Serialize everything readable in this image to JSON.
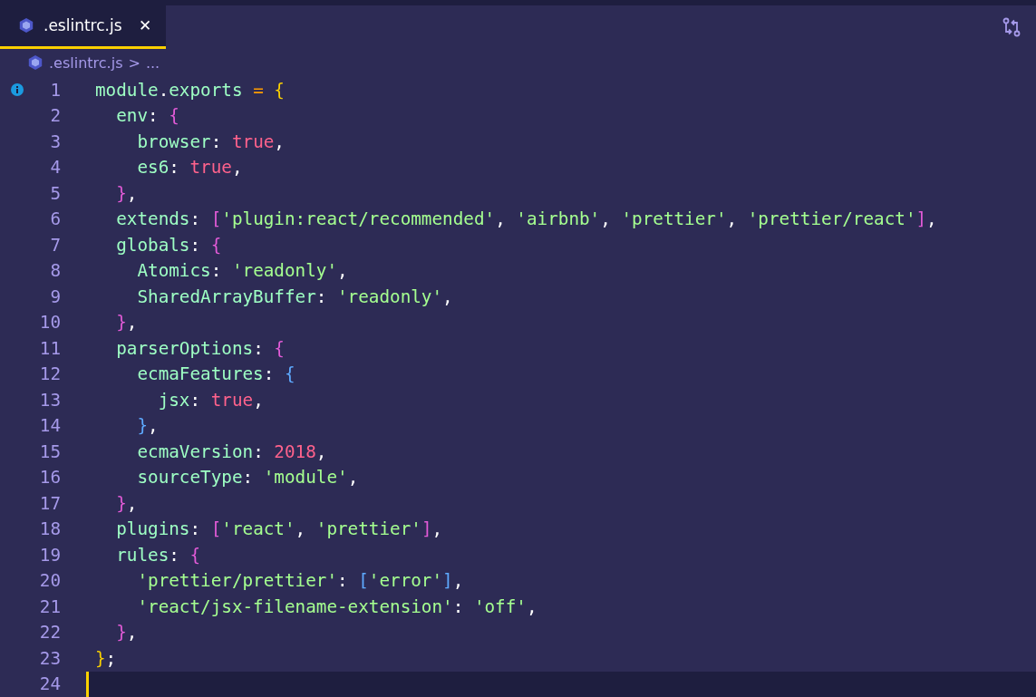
{
  "tab": {
    "title": ".eslintrc.js",
    "close": "✕",
    "selected": true
  },
  "breadcrumb": {
    "file": ".eslintrc.js",
    "separator": ">",
    "more": "..."
  },
  "lines": [
    {
      "number": "1",
      "info": true,
      "current": false,
      "tokens": [
        {
          "kind": "ident",
          "text": "module"
        },
        {
          "kind": "punct",
          "text": "."
        },
        {
          "kind": "ident",
          "text": "exports"
        },
        {
          "kind": "op",
          "text": " = "
        },
        {
          "kind": "open",
          "text": "{"
        }
      ]
    },
    {
      "number": "2",
      "info": false,
      "current": false,
      "tokens": [
        {
          "kind": "ident",
          "text": "  env"
        },
        {
          "kind": "punct",
          "text": ": "
        },
        {
          "kind": "open",
          "text": "{"
        }
      ]
    },
    {
      "number": "3",
      "info": false,
      "current": false,
      "tokens": [
        {
          "kind": "ident",
          "text": "    browser"
        },
        {
          "kind": "punct",
          "text": ": "
        },
        {
          "kind": "literal",
          "text": "true"
        },
        {
          "kind": "punct",
          "text": ","
        }
      ]
    },
    {
      "number": "4",
      "info": false,
      "current": false,
      "tokens": [
        {
          "kind": "ident",
          "text": "    es6"
        },
        {
          "kind": "punct",
          "text": ": "
        },
        {
          "kind": "literal",
          "text": "true"
        },
        {
          "kind": "punct",
          "text": ","
        }
      ]
    },
    {
      "number": "5",
      "info": false,
      "current": false,
      "tokens": [
        {
          "kind": "close",
          "text": "  }"
        },
        {
          "kind": "punct",
          "text": ","
        }
      ]
    },
    {
      "number": "6",
      "info": false,
      "current": false,
      "tokens": [
        {
          "kind": "ident",
          "text": "  extends"
        },
        {
          "kind": "punct",
          "text": ": "
        },
        {
          "kind": "open",
          "text": "["
        },
        {
          "kind": "string",
          "text": "'plugin:react/recommended'"
        },
        {
          "kind": "punct",
          "text": ", "
        },
        {
          "kind": "string",
          "text": "'airbnb'"
        },
        {
          "kind": "punct",
          "text": ", "
        },
        {
          "kind": "string",
          "text": "'prettier'"
        },
        {
          "kind": "punct",
          "text": ", "
        },
        {
          "kind": "string",
          "text": "'prettier/react'"
        },
        {
          "kind": "close",
          "text": "]"
        },
        {
          "kind": "punct",
          "text": ","
        }
      ]
    },
    {
      "number": "7",
      "info": false,
      "current": false,
      "tokens": [
        {
          "kind": "ident",
          "text": "  globals"
        },
        {
          "kind": "punct",
          "text": ": "
        },
        {
          "kind": "open",
          "text": "{"
        }
      ]
    },
    {
      "number": "8",
      "info": false,
      "current": false,
      "tokens": [
        {
          "kind": "ident",
          "text": "    Atomics"
        },
        {
          "kind": "punct",
          "text": ": "
        },
        {
          "kind": "string",
          "text": "'readonly'"
        },
        {
          "kind": "punct",
          "text": ","
        }
      ]
    },
    {
      "number": "9",
      "info": false,
      "current": false,
      "tokens": [
        {
          "kind": "ident",
          "text": "    SharedArrayBuffer"
        },
        {
          "kind": "punct",
          "text": ": "
        },
        {
          "kind": "string",
          "text": "'readonly'"
        },
        {
          "kind": "punct",
          "text": ","
        }
      ]
    },
    {
      "number": "10",
      "info": false,
      "current": false,
      "tokens": [
        {
          "kind": "close",
          "text": "  }"
        },
        {
          "kind": "punct",
          "text": ","
        }
      ]
    },
    {
      "number": "11",
      "info": false,
      "current": false,
      "tokens": [
        {
          "kind": "ident",
          "text": "  parserOptions"
        },
        {
          "kind": "punct",
          "text": ": "
        },
        {
          "kind": "open",
          "text": "{"
        }
      ]
    },
    {
      "number": "12",
      "info": false,
      "current": false,
      "tokens": [
        {
          "kind": "ident",
          "text": "    ecmaFeatures"
        },
        {
          "kind": "punct",
          "text": ": "
        },
        {
          "kind": "open",
          "text": "{"
        }
      ]
    },
    {
      "number": "13",
      "info": false,
      "current": false,
      "tokens": [
        {
          "kind": "ident",
          "text": "      jsx"
        },
        {
          "kind": "punct",
          "text": ": "
        },
        {
          "kind": "literal",
          "text": "true"
        },
        {
          "kind": "punct",
          "text": ","
        }
      ]
    },
    {
      "number": "14",
      "info": false,
      "current": false,
      "tokens": [
        {
          "kind": "close",
          "text": "    }"
        },
        {
          "kind": "punct",
          "text": ","
        }
      ]
    },
    {
      "number": "15",
      "info": false,
      "current": false,
      "tokens": [
        {
          "kind": "ident",
          "text": "    ecmaVersion"
        },
        {
          "kind": "punct",
          "text": ": "
        },
        {
          "kind": "literal",
          "text": "2018"
        },
        {
          "kind": "punct",
          "text": ","
        }
      ]
    },
    {
      "number": "16",
      "info": false,
      "current": false,
      "tokens": [
        {
          "kind": "ident",
          "text": "    sourceType"
        },
        {
          "kind": "punct",
          "text": ": "
        },
        {
          "kind": "string",
          "text": "'module'"
        },
        {
          "kind": "punct",
          "text": ","
        }
      ]
    },
    {
      "number": "17",
      "info": false,
      "current": false,
      "tokens": [
        {
          "kind": "close",
          "text": "  }"
        },
        {
          "kind": "punct",
          "text": ","
        }
      ]
    },
    {
      "number": "18",
      "info": false,
      "current": false,
      "tokens": [
        {
          "kind": "ident",
          "text": "  plugins"
        },
        {
          "kind": "punct",
          "text": ": "
        },
        {
          "kind": "open",
          "text": "["
        },
        {
          "kind": "string",
          "text": "'react'"
        },
        {
          "kind": "punct",
          "text": ", "
        },
        {
          "kind": "string",
          "text": "'prettier'"
        },
        {
          "kind": "close",
          "text": "]"
        },
        {
          "kind": "punct",
          "text": ","
        }
      ]
    },
    {
      "number": "19",
      "info": false,
      "current": false,
      "tokens": [
        {
          "kind": "ident",
          "text": "  rules"
        },
        {
          "kind": "punct",
          "text": ": "
        },
        {
          "kind": "open",
          "text": "{"
        }
      ]
    },
    {
      "number": "20",
      "info": false,
      "current": false,
      "tokens": [
        {
          "kind": "string",
          "text": "    'prettier/prettier'"
        },
        {
          "kind": "punct",
          "text": ": "
        },
        {
          "kind": "open",
          "text": "["
        },
        {
          "kind": "string",
          "text": "'error'"
        },
        {
          "kind": "close",
          "text": "]"
        },
        {
          "kind": "punct",
          "text": ","
        }
      ]
    },
    {
      "number": "21",
      "info": false,
      "current": false,
      "tokens": [
        {
          "kind": "string",
          "text": "    'react/jsx-filename-extension'"
        },
        {
          "kind": "punct",
          "text": ": "
        },
        {
          "kind": "string",
          "text": "'off'"
        },
        {
          "kind": "punct",
          "text": ","
        }
      ]
    },
    {
      "number": "22",
      "info": false,
      "current": false,
      "tokens": [
        {
          "kind": "close",
          "text": "  }"
        },
        {
          "kind": "punct",
          "text": ","
        }
      ]
    },
    {
      "number": "23",
      "info": false,
      "current": false,
      "tokens": [
        {
          "kind": "close",
          "text": "}"
        },
        {
          "kind": "punct",
          "text": ";"
        }
      ]
    },
    {
      "number": "24",
      "info": false,
      "current": true
    }
  ]
}
